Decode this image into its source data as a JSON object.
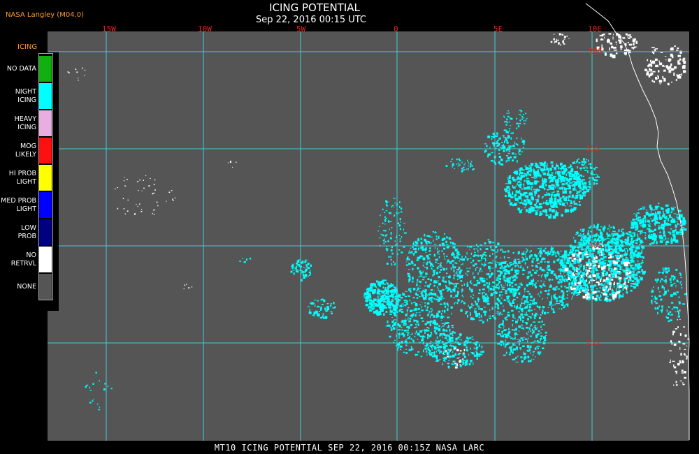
{
  "header": {
    "organization": "NASA Langley (M04.0)",
    "title": "ICING POTENTIAL",
    "datetime": "Sep 22, 2016 00:15 UTC"
  },
  "map": {
    "longitude_labels": [
      "15W",
      "10W",
      "5W",
      "0",
      "5E",
      "10E"
    ],
    "latitude_labels": [
      "35S",
      "30S",
      "25S",
      "20S"
    ],
    "colors": {
      "background": "#555555",
      "grid": "#3fd0d8",
      "coastline": "#ffffff",
      "night_icing": "#00ffff",
      "no_retrieval": "#ffffff"
    }
  },
  "legend": {
    "title": "ICING",
    "items": [
      {
        "label": "NO DATA",
        "color": "#10b010"
      },
      {
        "label": "NIGHT\nICING",
        "color": "#00ffff"
      },
      {
        "label": "HEAVY\nICING",
        "color": "#e8aee0"
      },
      {
        "label": "MOG\nLIKELY",
        "color": "#ff1010"
      },
      {
        "label": "HI PROB\nLIGHT",
        "color": "#ffff00"
      },
      {
        "label": "MED PROB\nLIGHT",
        "color": "#0000ff"
      },
      {
        "label": "LOW\nPROB",
        "color": "#000080"
      },
      {
        "label": "NO\nRETRVL",
        "color": "#ffffff"
      },
      {
        "label": "NONE",
        "color": "#555555"
      }
    ]
  },
  "footer": {
    "caption": "MT10  ICING POTENTIAL   SEP 22, 2016 00:15Z   NASA LARC"
  }
}
